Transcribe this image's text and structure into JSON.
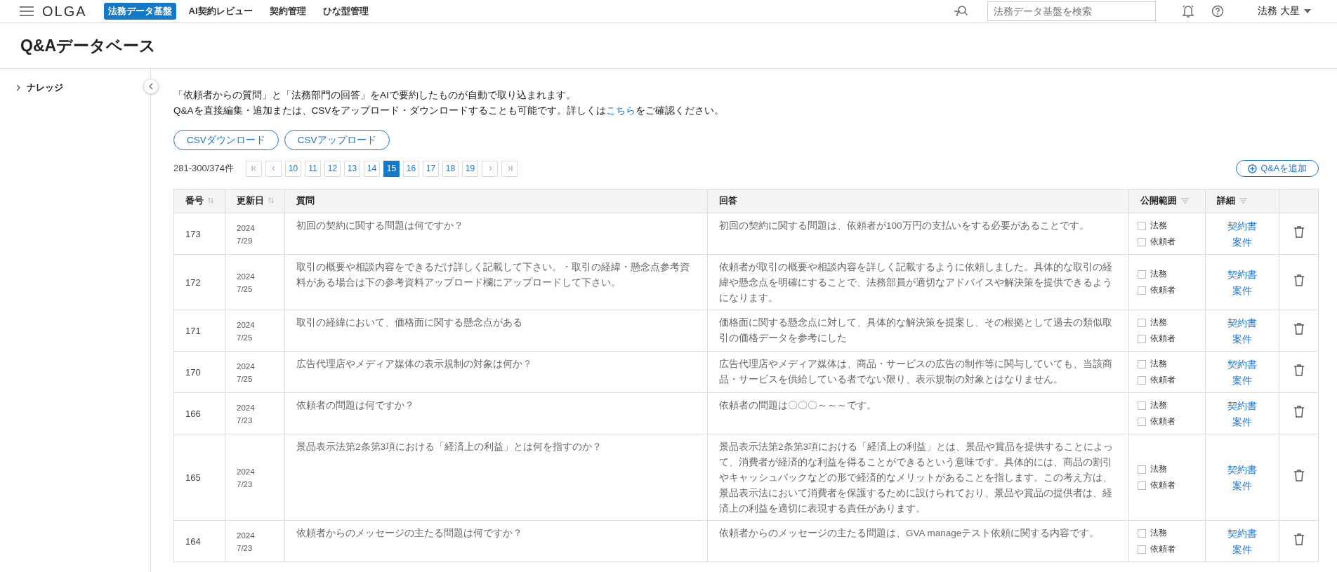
{
  "topbar": {
    "logo": "OLGA",
    "nav": [
      {
        "label": "法務データ基盤",
        "selected": true
      },
      {
        "label": "AI契約レビュー",
        "selected": false
      },
      {
        "label": "契約管理",
        "selected": false
      },
      {
        "label": "ひな型管理",
        "selected": false
      }
    ],
    "search": {
      "placeholder": "法務データ基盤を検索"
    },
    "user": "法務 大星"
  },
  "page_title": "Q&Aデータベース",
  "sidebar": {
    "items": [
      {
        "label": "ナレッジ",
        "expanded": false
      }
    ]
  },
  "intro": {
    "line_1": "「依頼者からの質問」と「法務部門の回答」をAIで要約したものが自動で取り込まれます。",
    "line_2_before": "Q&Aを直接編集・追加または、CSVをアップロード・ダウンロードすることも可能です。詳しくは",
    "link": "こちら",
    "line_2_after": "をご確認ください。"
  },
  "csv_buttons": [
    "CSVダウンロード",
    "CSVアップロード"
  ],
  "pagination": {
    "count": "281-300/374件",
    "pages": [
      {
        "label": "10",
        "selected": false
      },
      {
        "label": "11",
        "selected": false
      },
      {
        "label": "12",
        "selected": false
      },
      {
        "label": "13",
        "selected": false
      },
      {
        "label": "14",
        "selected": false
      },
      {
        "label": "15",
        "selected": true
      },
      {
        "label": "16",
        "selected": false
      },
      {
        "label": "17",
        "selected": false
      },
      {
        "label": "18",
        "selected": false
      },
      {
        "label": "19",
        "selected": false
      }
    ]
  },
  "add_button": "Q&Aを追加",
  "table": {
    "columns": [
      {
        "label": "番号",
        "kind": "sort"
      },
      {
        "label": "更新日",
        "kind": "sort"
      },
      {
        "label": "質問",
        "kind": "plain"
      },
      {
        "label": "回答",
        "kind": "plain"
      },
      {
        "label": "公開範囲",
        "kind": "filter"
      },
      {
        "label": "詳細",
        "kind": "filter"
      }
    ],
    "rows": [
      {
        "number": "173",
        "year": "2024",
        "month_day": "7/29",
        "question": "初回の契約に関する問題は何ですか？",
        "answer": "初回の契約に関する問題は、依頼者が100万円の支払いをする必要があることです。",
        "visibility": [
          {
            "label": "法務",
            "checked": false
          },
          {
            "label": "依頼者",
            "checked": false
          }
        ],
        "links": [
          "契約書",
          "案件"
        ]
      },
      {
        "number": "172",
        "year": "2024",
        "month_day": "7/25",
        "question": "取引の概要や相談内容をできるだけ詳しく記載して下さい。・取引の経緯・懸念点参考資料がある場合は下の参考資料アップロード欄にアップロードして下さい。",
        "answer": "依頼者が取引の概要や相談内容を詳しく記載するように依頼しました。具体的な取引の経緯や懸念点を明確にすることで、法務部員が適切なアドバイスや解決策を提供できるようになります。",
        "visibility": [
          {
            "label": "法務",
            "checked": false
          },
          {
            "label": "依頼者",
            "checked": false
          }
        ],
        "links": [
          "契約書",
          "案件"
        ]
      },
      {
        "number": "171",
        "year": "2024",
        "month_day": "7/25",
        "question": "取引の経緯において、価格面に関する懸念点がある",
        "answer": "価格面に関する懸念点に対して、具体的な解決策を提案し、その根拠として過去の類似取引の価格データを参考にした",
        "visibility": [
          {
            "label": "法務",
            "checked": false
          },
          {
            "label": "依頼者",
            "checked": false
          }
        ],
        "links": [
          "契約書",
          "案件"
        ]
      },
      {
        "number": "170",
        "year": "2024",
        "month_day": "7/25",
        "question": "広告代理店やメディア媒体の表示規制の対象は何か？",
        "answer": "広告代理店やメディア媒体は、商品・サービスの広告の制作等に関与していても、当該商品・サービスを供給している者でない限り、表示規制の対象とはなりません。",
        "visibility": [
          {
            "label": "法務",
            "checked": false
          },
          {
            "label": "依頼者",
            "checked": false
          }
        ],
        "links": [
          "契約書",
          "案件"
        ]
      },
      {
        "number": "166",
        "year": "2024",
        "month_day": "7/23",
        "question": "依頼者の問題は何ですか？",
        "answer": "依頼者の問題は〇〇〇～～～です。",
        "visibility": [
          {
            "label": "法務",
            "checked": false
          },
          {
            "label": "依頼者",
            "checked": false
          }
        ],
        "links": [
          "契約書",
          "案件"
        ]
      },
      {
        "number": "165",
        "year": "2024",
        "month_day": "7/23",
        "question": "景品表示法第2条第3項における「経済上の利益」とは何を指すのか？",
        "answer": "景品表示法第2条第3項における「経済上の利益」とは、景品や賞品を提供することによって、消費者が経済的な利益を得ることができるという意味です。具体的には、商品の割引やキャッシュバックなどの形で経済的なメリットがあることを指します。この考え方は、景品表示法において消費者を保護するために設けられており、景品や賞品の提供者は、経済上の利益を適切に表現する責任があります。",
        "visibility": [
          {
            "label": "法務",
            "checked": false
          },
          {
            "label": "依頼者",
            "checked": false
          }
        ],
        "links": [
          "契約書",
          "案件"
        ]
      },
      {
        "number": "164",
        "year": "2024",
        "month_day": "7/23",
        "question": "依頼者からのメッセージの主たる問題は何ですか？",
        "answer": "依頼者からのメッセージの主たる問題は、GVA manageテスト依頼に関する内容です。",
        "visibility": [
          {
            "label": "法務",
            "checked": false
          },
          {
            "label": "依頼者",
            "checked": false
          }
        ],
        "links": [
          "契約書",
          "案件"
        ]
      }
    ]
  }
}
